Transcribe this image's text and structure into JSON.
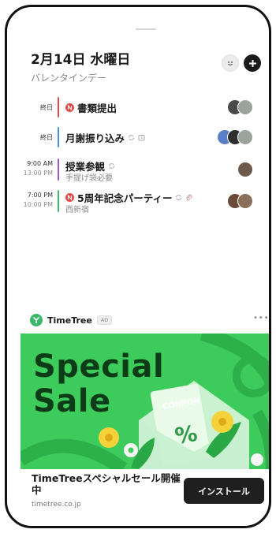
{
  "header": {
    "date": "2月14日 水曜日",
    "holiday": "バレンタインデー"
  },
  "events": [
    {
      "start": "終日",
      "end": "",
      "title": "書類提出",
      "subtitle": "",
      "color": "#e54848",
      "badge": "N",
      "repeat": false,
      "reminder": false,
      "attach": false
    },
    {
      "start": "終日",
      "end": "",
      "title": "月謝振り込み",
      "subtitle": "",
      "color": "#4a90e2",
      "badge": "",
      "repeat": true,
      "reminder": true,
      "attach": false
    },
    {
      "start": "9:00 AM",
      "end": "13:00 PM",
      "title": "授業参観",
      "subtitle": "手提げ袋必要",
      "color": "#9b59d0",
      "badge": "",
      "repeat": true,
      "reminder": false,
      "attach": false
    },
    {
      "start": "7:00 PM",
      "end": "10:00 PM",
      "title": "5周年記念パーティー",
      "subtitle": "西新宿",
      "color": "#3bb86a",
      "badge": "N",
      "repeat": true,
      "reminder": false,
      "attach": true
    }
  ],
  "ad": {
    "brand": "TimeTree",
    "tag": "AD",
    "more": "•••",
    "banner_line1": "Special",
    "banner_line2": "Sale",
    "coupon": "COUPON",
    "coupon_symbol": "%",
    "title": "TimeTreeスペシャルセール開催中",
    "url": "timetree.co.jp",
    "install_label": "インストール"
  },
  "colors": {
    "ad_green": "#3dcb5b",
    "badge_red": "#e54848"
  }
}
